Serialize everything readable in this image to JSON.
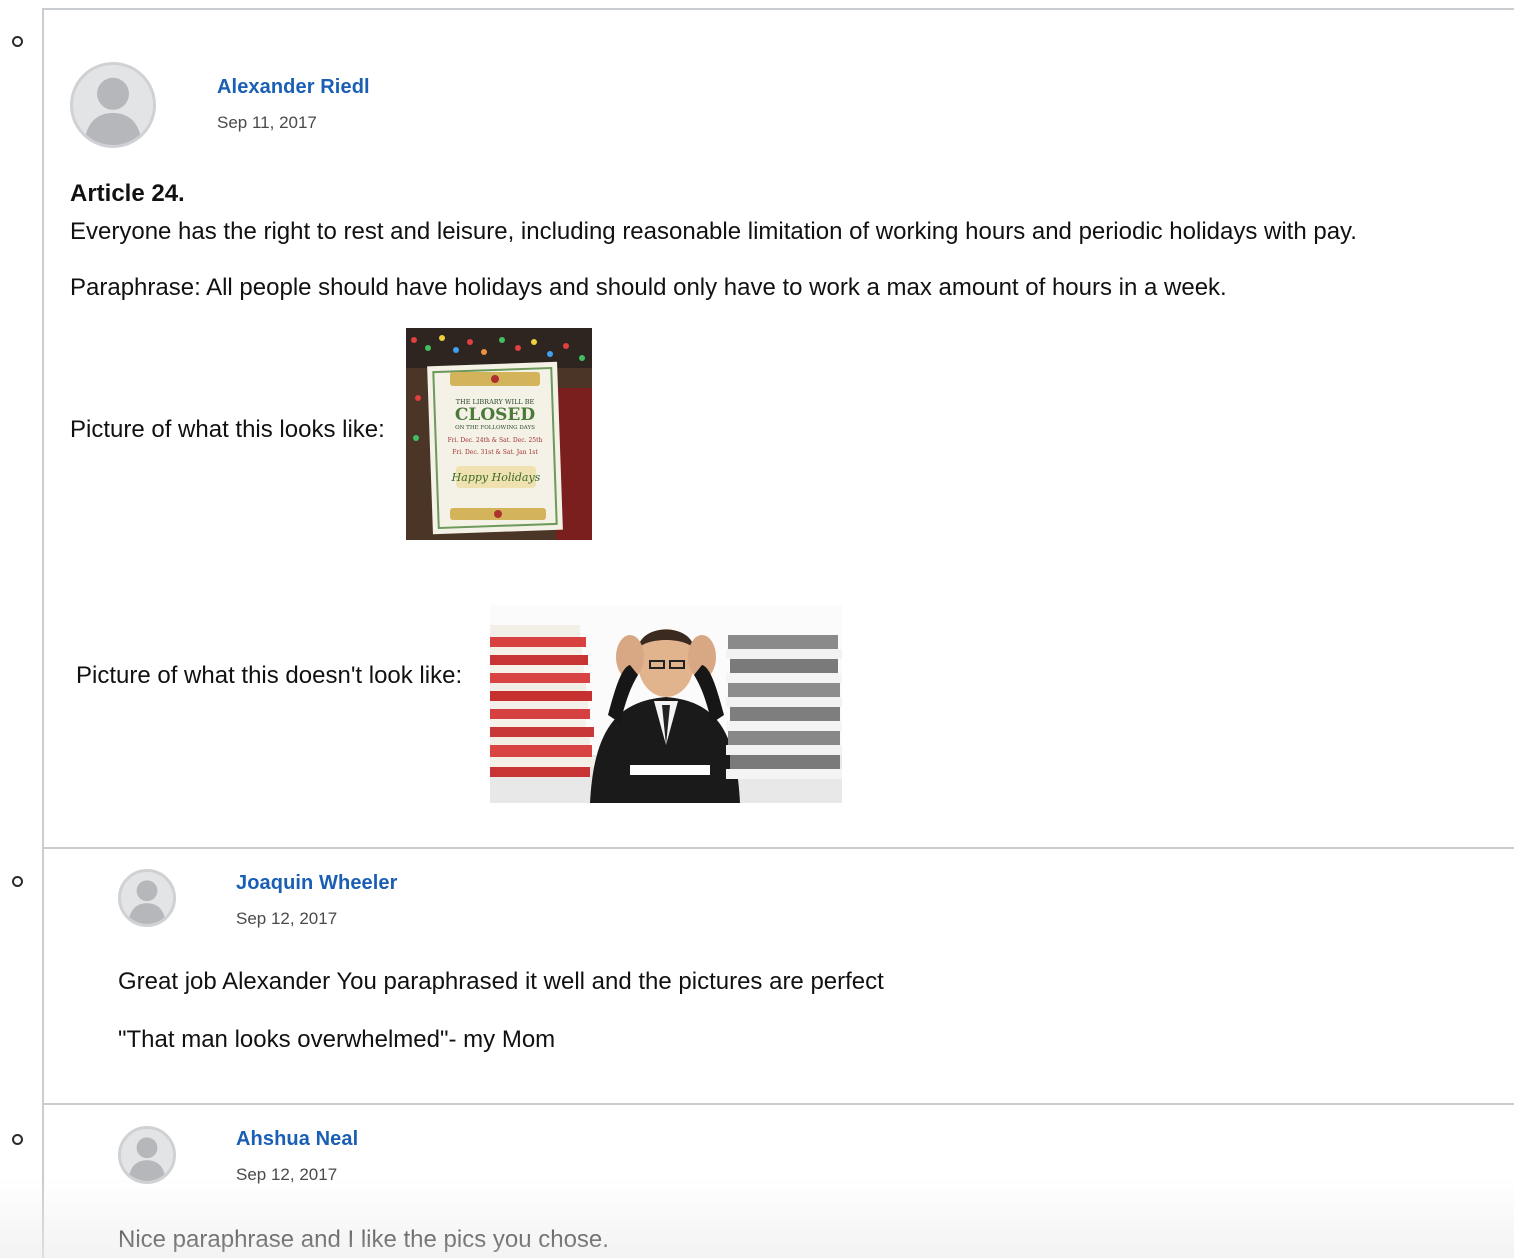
{
  "posts": [
    {
      "author": "Alexander Riedl",
      "date": "Sep 11, 2017",
      "title": "Article 24.",
      "body": "Everyone has the right to rest and leisure, including reasonable limitation of working hours and periodic holidays with pay.",
      "paraphrase": "Paraphrase: All people should have holidays and should only have to work a max amount of hours in a week.",
      "picture1_label": "Picture of what this looks like:",
      "picture2_label": "Picture of what this doesn't look like:",
      "sign": {
        "line1": "THE LIBRARY WILL BE",
        "line2": "CLOSED",
        "line3": "ON THE FOLLOWING DAYS",
        "line4": "Fri. Dec. 24th & Sat. Dec. 25th",
        "line5": "Fri. Dec. 31st & Sat. Jan 1st",
        "line6": "Happy Holidays"
      }
    }
  ],
  "replies": [
    {
      "author": "Joaquin Wheeler",
      "date": "Sep 12, 2017",
      "line1": "Great job Alexander You paraphrased it well and the pictures are perfect",
      "line2": "\"That man looks overwhelmed\"- my Mom"
    },
    {
      "author": "Ahshua Neal",
      "date": "Sep 12, 2017",
      "line1": "Nice paraphrase and I like the pics you chose."
    }
  ],
  "icons": {
    "bullet": "hollow-circle-bullet-icon",
    "avatar": "default-user-avatar-icon"
  },
  "colors": {
    "author_link": "#1a5fb4",
    "divider": "#c9ccd0"
  }
}
